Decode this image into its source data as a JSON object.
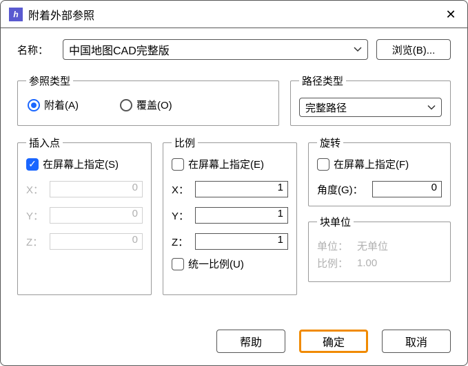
{
  "window": {
    "title": "附着外部参照"
  },
  "name": {
    "label": "名称：",
    "value": "中国地图CAD完整版",
    "browse": "浏览(B)..."
  },
  "ref_type": {
    "legend": "参照类型",
    "attach": "附着(A)",
    "overlay": "覆盖(O)"
  },
  "path_type": {
    "legend": "路径类型",
    "value": "完整路径"
  },
  "insert": {
    "legend": "插入点",
    "onscreen": "在屏幕上指定(S)",
    "x_label": "X：",
    "y_label": "Y：",
    "z_label": "Z：",
    "x": "0",
    "y": "0",
    "z": "0"
  },
  "scale": {
    "legend": "比例",
    "onscreen": "在屏幕上指定(E)",
    "x_label": "X：",
    "y_label": "Y：",
    "z_label": "Z：",
    "x": "1",
    "y": "1",
    "z": "1",
    "uniform": "统一比例(U)"
  },
  "rotate": {
    "legend": "旋转",
    "onscreen": "在屏幕上指定(F)",
    "angle_label": "角度(G)：",
    "angle": "0"
  },
  "block_unit": {
    "legend": "块单位",
    "unit_label": "单位：",
    "unit_value": "无单位",
    "scale_label": "比例：",
    "scale_value": "1.00"
  },
  "footer": {
    "help": "帮助",
    "ok": "确定",
    "cancel": "取消"
  }
}
